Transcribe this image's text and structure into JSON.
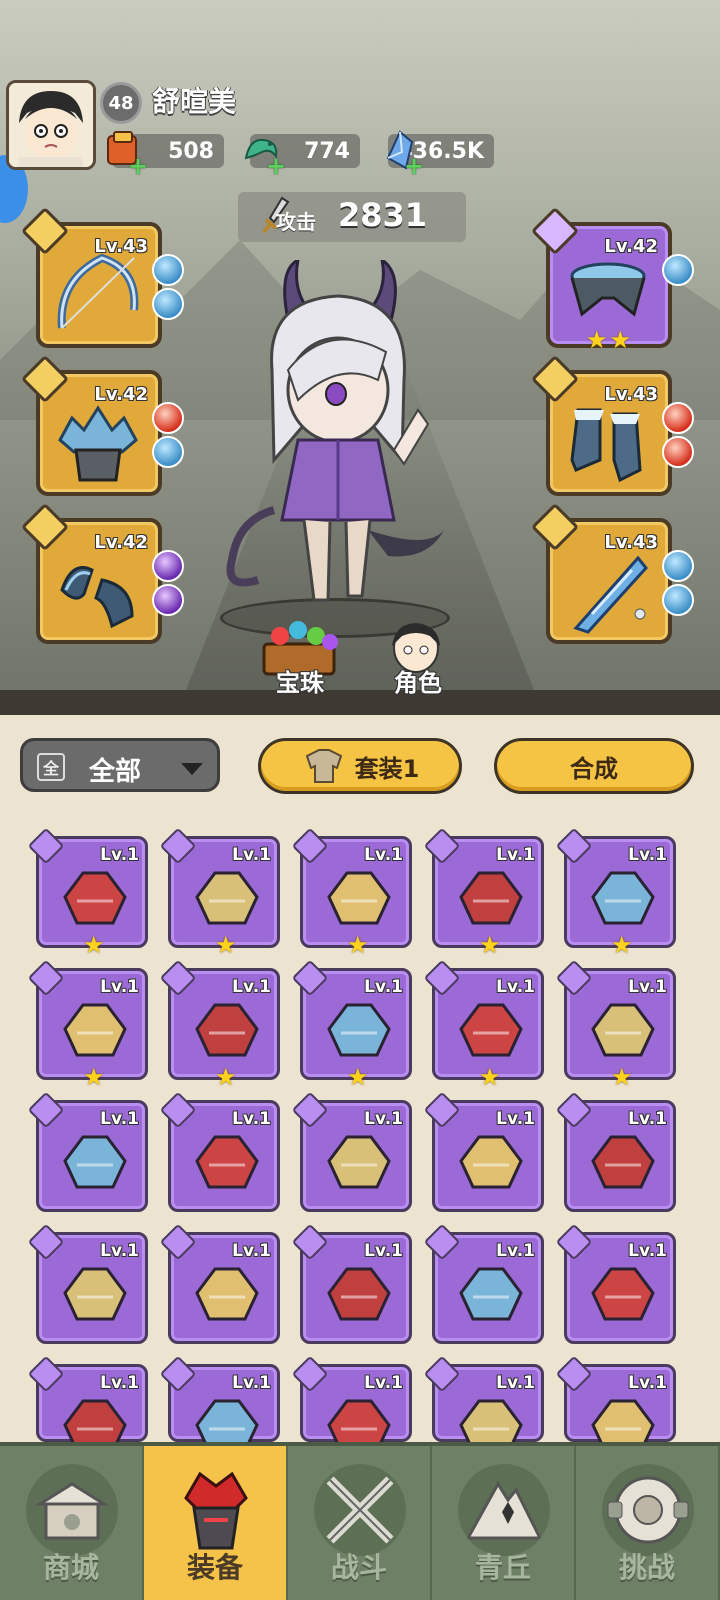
{
  "player": {
    "level": "48",
    "name": "舒暄美"
  },
  "resources": [
    {
      "icon": "scroll-pack-icon",
      "value": "508"
    },
    {
      "icon": "jade-dragon-icon",
      "value": "774"
    },
    {
      "icon": "crystal-icon",
      "value": "436.5K"
    }
  ],
  "attack": {
    "label": "攻击",
    "value": "2831"
  },
  "equipped": {
    "left": [
      {
        "slot": "weapon",
        "level": "Lv.43",
        "gems": [
          "blue",
          "blue"
        ]
      },
      {
        "slot": "helmet",
        "level": "Lv.42",
        "gems": [
          "red",
          "blue"
        ]
      },
      {
        "slot": "bracer",
        "level": "Lv.42",
        "gems": [
          "violet",
          "violet"
        ]
      }
    ],
    "right": [
      {
        "slot": "belt",
        "level": "Lv.42",
        "gems": [
          "blue"
        ],
        "stars": 2
      },
      {
        "slot": "boots",
        "level": "Lv.43",
        "gems": [
          "red",
          "red"
        ]
      },
      {
        "slot": "amulet",
        "level": "Lv.43",
        "gems": [
          "blue",
          "blue"
        ]
      }
    ]
  },
  "quick_buttons": {
    "gems": "宝珠",
    "character": "角色"
  },
  "filter": {
    "box": "全",
    "label": "全部"
  },
  "buttons": {
    "set": "套装1",
    "synthesize": "合成"
  },
  "inventory": [
    {
      "level": "Lv.1",
      "stars": 1
    },
    {
      "level": "Lv.1",
      "stars": 1
    },
    {
      "level": "Lv.1",
      "stars": 1
    },
    {
      "level": "Lv.1",
      "stars": 1
    },
    {
      "level": "Lv.1",
      "stars": 1
    },
    {
      "level": "Lv.1",
      "stars": 1
    },
    {
      "level": "Lv.1",
      "stars": 1
    },
    {
      "level": "Lv.1",
      "stars": 1
    },
    {
      "level": "Lv.1",
      "stars": 1
    },
    {
      "level": "Lv.1",
      "stars": 1
    },
    {
      "level": "Lv.1",
      "stars": 0
    },
    {
      "level": "Lv.1",
      "stars": 0
    },
    {
      "level": "Lv.1",
      "stars": 0
    },
    {
      "level": "Lv.1",
      "stars": 0
    },
    {
      "level": "Lv.1",
      "stars": 0
    },
    {
      "level": "Lv.1",
      "stars": 0
    },
    {
      "level": "Lv.1",
      "stars": 0
    },
    {
      "level": "Lv.1",
      "stars": 0
    },
    {
      "level": "Lv.1",
      "stars": 0
    },
    {
      "level": "Lv.1",
      "stars": 0
    },
    {
      "level": "Lv.1",
      "stars": 0
    },
    {
      "level": "Lv.1",
      "stars": 0
    },
    {
      "level": "Lv.1",
      "stars": 0
    },
    {
      "level": "Lv.1",
      "stars": 0
    },
    {
      "level": "Lv.1",
      "stars": 0
    }
  ],
  "nav": [
    {
      "label": "商城",
      "icon": "shop-icon",
      "active": false
    },
    {
      "label": "装备",
      "icon": "armor-icon",
      "active": true
    },
    {
      "label": "战斗",
      "icon": "crossed-swords-icon",
      "active": false
    },
    {
      "label": "青丘",
      "icon": "mountain-icon",
      "active": false
    },
    {
      "label": "挑战",
      "icon": "challenge-icon",
      "active": false
    }
  ]
}
